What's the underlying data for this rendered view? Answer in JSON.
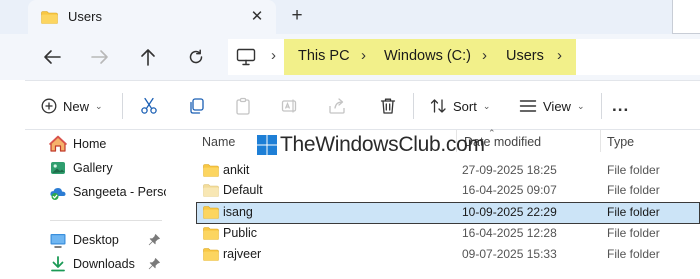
{
  "tab": {
    "title": "Users",
    "close_icon": "close-icon",
    "new_tab_icon": "plus-icon"
  },
  "nav": {
    "back_icon": "arrow-left-icon",
    "forward_icon": "arrow-right-icon",
    "up_icon": "arrow-up-icon",
    "refresh_icon": "refresh-icon",
    "breadcrumb": [
      "This PC",
      "Windows (C:)",
      "Users"
    ],
    "breadcrumb_highlight_color": "#f2f08a"
  },
  "toolbar": {
    "new_label": "New",
    "sort_label": "Sort",
    "view_label": "View",
    "more_label": "..."
  },
  "sidebar": {
    "items": [
      {
        "label": "Home",
        "icon": "home-icon"
      },
      {
        "label": "Gallery",
        "icon": "gallery-icon"
      },
      {
        "label": "Sangeeta - Persor",
        "icon": "onedrive-icon"
      },
      {
        "label": "Desktop",
        "icon": "desktop-icon",
        "pinned": true
      },
      {
        "label": "Downloads",
        "icon": "downloads-icon",
        "pinned": true
      }
    ]
  },
  "file_list": {
    "columns": [
      "Name",
      "Date modified",
      "Type"
    ],
    "rows": [
      {
        "name": "ankit",
        "date": "27-09-2025 18:25",
        "type": "File folder"
      },
      {
        "name": "Default",
        "date": "16-04-2025 09:07",
        "type": "File folder"
      },
      {
        "name": "isang",
        "date": "10-09-2025 22:29",
        "type": "File folder",
        "selected": true
      },
      {
        "name": "Public",
        "date": "16-04-2025 12:28",
        "type": "File folder"
      },
      {
        "name": "rajveer",
        "date": "09-07-2025 15:33",
        "type": "File folder"
      }
    ],
    "selection_color": "#cce4f7"
  },
  "watermark": {
    "text": "TheWindowsClub.com"
  },
  "colors": {
    "accent": "#0067c0",
    "folder": "#f8c744"
  }
}
